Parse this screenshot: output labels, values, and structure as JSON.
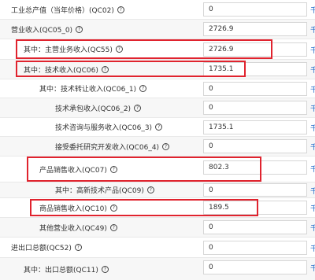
{
  "unit_label": "千",
  "help_glyph": "?",
  "rows": [
    {
      "label": "工业总产值（当年价格）(QC02)",
      "value": "0"
    },
    {
      "label": "营业收入(QC05_0)",
      "value": "2726.9"
    },
    {
      "label": "其中：主营业务收入(QC55)",
      "value": "2726.9"
    },
    {
      "label": "其中：技术收入(QC06)",
      "value": "1735.1"
    },
    {
      "label": "其中：技术转让收入(QC06_1)",
      "value": "0"
    },
    {
      "label": "技术承包收入(QC06_2)",
      "value": "0"
    },
    {
      "label": "技术咨询与服务收入(QC06_3)",
      "value": "1735.1"
    },
    {
      "label": "接受委托研究开发收入(QC06_4)",
      "value": "0"
    },
    {
      "label": "产品销售收入(QC07)",
      "value": "802.3"
    },
    {
      "label": "其中：高新技术产品(QC09)",
      "value": "0"
    },
    {
      "label": "商品销售收入(QC10)",
      "value": "189.5"
    },
    {
      "label": "其他营业收入(QC49)",
      "value": "0"
    },
    {
      "label": "进出口总额(QC52)",
      "value": "0"
    },
    {
      "label": "其中：出口总额(QC11)",
      "value": "0"
    }
  ]
}
